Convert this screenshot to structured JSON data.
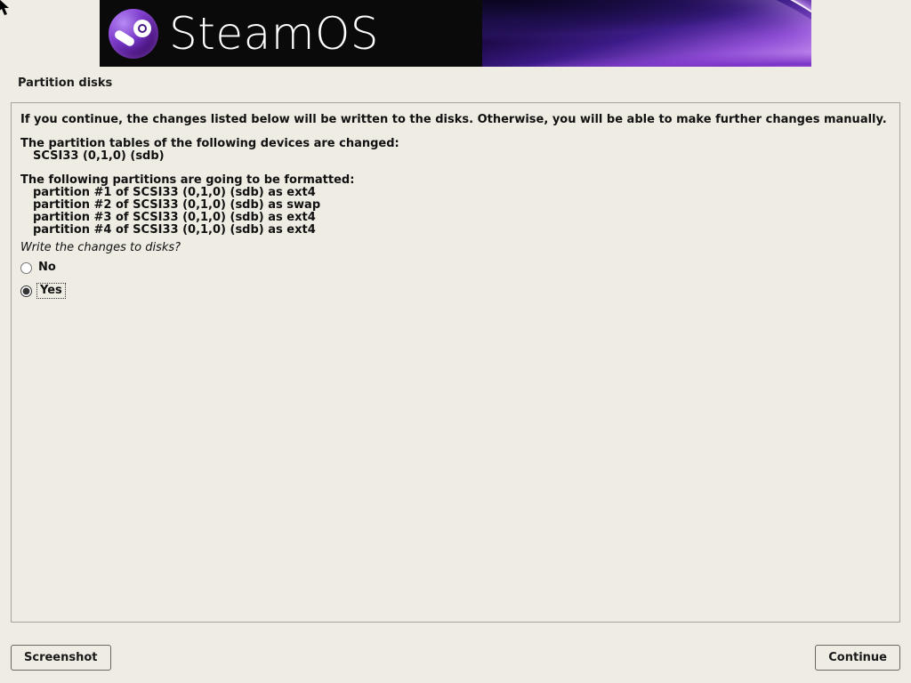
{
  "header": {
    "brand": "SteamOS"
  },
  "section_title": "Partition disks",
  "body": {
    "intro": "If you continue, the changes listed below will be written to the disks. Otherwise, you will be able to make further changes manually.",
    "tables_heading": "The partition tables of the following devices are changed:",
    "tables_items": [
      "SCSI33 (0,1,0) (sdb)"
    ],
    "format_heading": "The following partitions are going to be formatted:",
    "format_items": [
      "partition #1 of SCSI33 (0,1,0) (sdb) as ext4",
      "partition #2 of SCSI33 (0,1,0) (sdb) as swap",
      "partition #3 of SCSI33 (0,1,0) (sdb) as ext4",
      "partition #4 of SCSI33 (0,1,0) (sdb) as ext4"
    ],
    "prompt": "Write the changes to disks?"
  },
  "options": {
    "no_label": "No",
    "yes_label": "Yes",
    "selected": "yes"
  },
  "footer": {
    "screenshot_label": "Screenshot",
    "continue_label": "Continue"
  }
}
